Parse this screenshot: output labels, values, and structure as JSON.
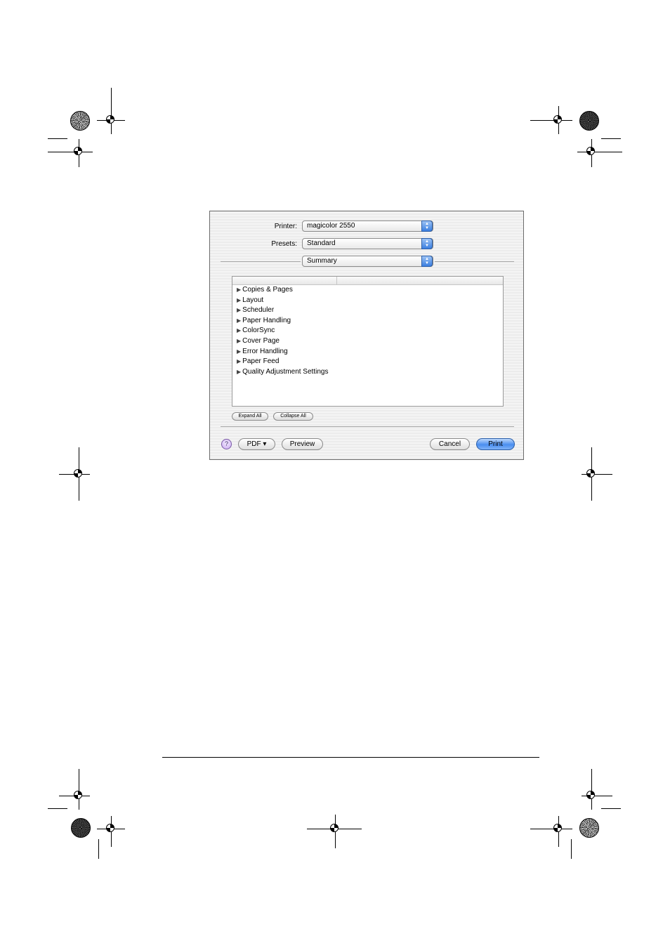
{
  "dialog": {
    "printer_label": "Printer:",
    "printer_value": "magicolor 2550",
    "presets_label": "Presets:",
    "presets_value": "Standard",
    "panel_value": "Summary"
  },
  "summary": {
    "items": [
      "Copies & Pages",
      "Layout",
      "Scheduler",
      "Paper Handling",
      "ColorSync",
      "Cover Page",
      "Error Handling",
      "Paper Feed",
      "Quality Adjustment Settings"
    ],
    "expand_all": "Expand All",
    "collapse_all": "Collapse All"
  },
  "footer": {
    "help": "?",
    "pdf": "PDF ▾",
    "preview": "Preview",
    "cancel": "Cancel",
    "print": "Print"
  },
  "icons": {
    "disclosure": "disclosure-triangle-icon",
    "stepper": "popup-stepper-icon",
    "help": "help-icon"
  },
  "colors": {
    "accent": "#3b7fe0",
    "help_accent": "#c9a9f0"
  }
}
